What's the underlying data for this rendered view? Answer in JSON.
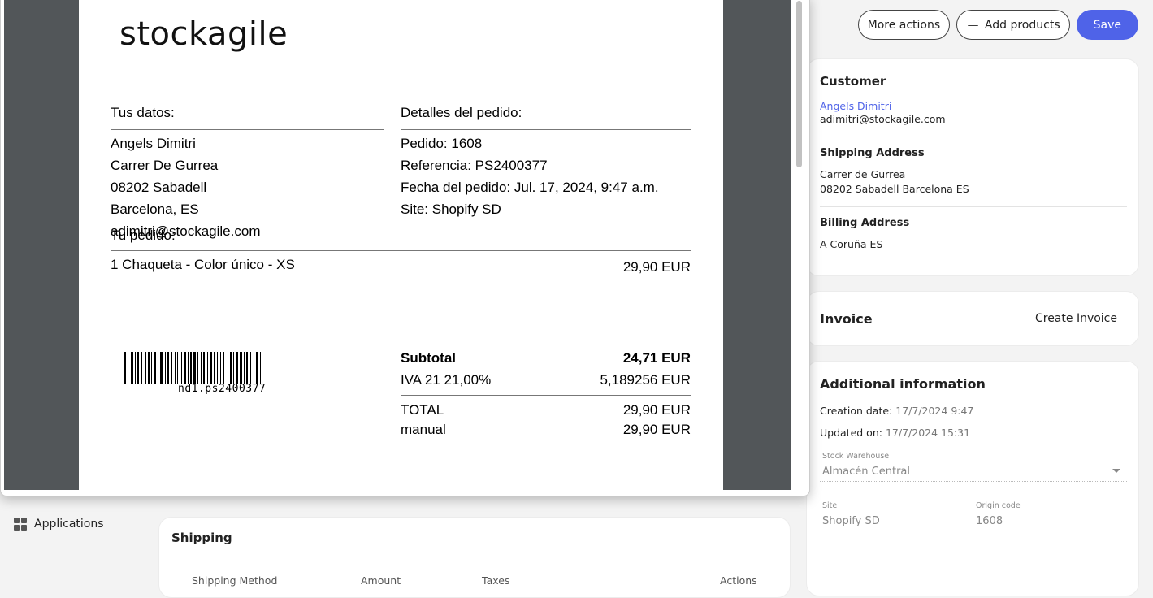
{
  "toolbar": {
    "more_actions": "More actions",
    "add_products": "Add products",
    "save": "Save"
  },
  "customer": {
    "title": "Customer",
    "name": "Angels Dimitri",
    "email": "adimitri@stockagile.com",
    "shipping_title": "Shipping Address",
    "shipping_line1": "Carrer de Gurrea",
    "shipping_line2": "08202 Sabadell Barcelona ES",
    "billing_title": "Billing Address",
    "billing_line1": "A Coruña ES"
  },
  "invoice": {
    "title": "Invoice",
    "create": "Create Invoice"
  },
  "additional": {
    "title": "Additional information",
    "creation_label": "Creation date:",
    "creation_value": "17/7/2024 9:47",
    "updated_label": "Updated on:",
    "updated_value": "17/7/2024 15:31",
    "warehouse_label": "Stock Warehouse",
    "warehouse_value": "Almacén Central",
    "site_label": "Site",
    "site_value": "Shopify SD",
    "origin_label": "Origin code",
    "origin_value": "1608"
  },
  "sidebar": {
    "applications": "Applications"
  },
  "shipping": {
    "title": "Shipping",
    "columns": [
      "Shipping Method",
      "Amount",
      "Taxes",
      "Actions"
    ]
  },
  "doc": {
    "logo": "stockagile",
    "your_data_title": "Tus datos:",
    "order_details_title": "Detalles del pedido:",
    "customer_lines": [
      "Angels Dimitri",
      "Carrer De Gurrea",
      "08202 Sabadell",
      "Barcelona, ES",
      "adimitri@stockagile.com"
    ],
    "order_lines": [
      "Pedido: 1608",
      "Referencia: PS2400377",
      "Fecha del pedido: Jul. 17, 2024, 9:47 a.m.",
      "Site: Shopify SD"
    ],
    "your_order_title": "Tu pedido:",
    "item_desc": "1 Chaqueta - Color único - XS",
    "item_price": "29,90 EUR",
    "subtotal_label": "Subtotal",
    "subtotal_value": "24,71 EUR",
    "tax_label": "IVA 21 21,00%",
    "tax_value": "5,189256 EUR",
    "total_label": "TOTAL",
    "total_value": "29,90 EUR",
    "manual_label": "manual",
    "manual_value": "29,90 EUR",
    "barcode_text": "nd1.ps2400377"
  }
}
